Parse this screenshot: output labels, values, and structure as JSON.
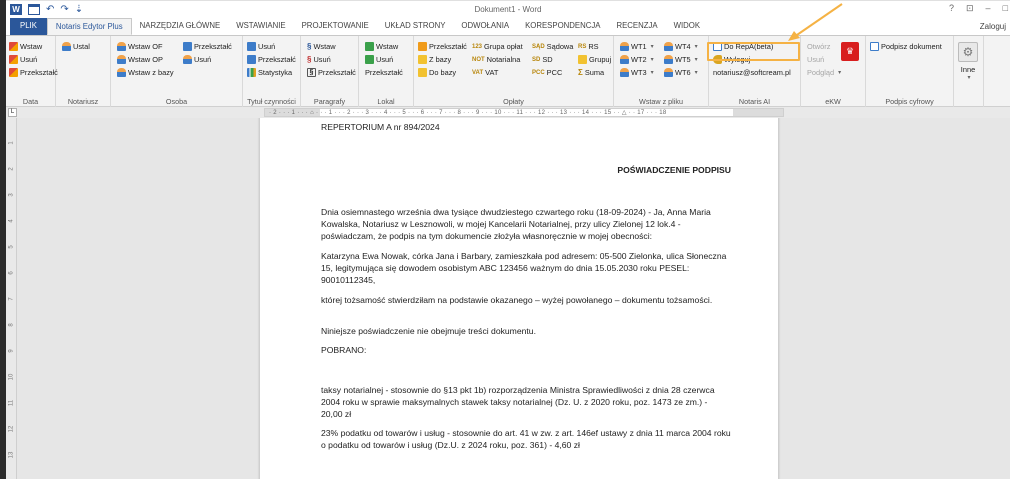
{
  "window": {
    "title": "Dokument1 - Word",
    "controls": [
      "?",
      "⊡",
      "–",
      "□"
    ],
    "login": "Zaloguj"
  },
  "quick_access": [
    "word-logo",
    "save-icon",
    "undo-icon",
    "redo-icon",
    "customize-icon"
  ],
  "tabs": [
    "PLIK",
    "Notaris Edytor Plus",
    "NARZĘDZIA GŁÓWNE",
    "WSTAWIANIE",
    "PROJEKTOWANIE",
    "UKŁAD STRONY",
    "ODWOŁANIA",
    "KORESPONDENCJA",
    "RECENZJA",
    "WIDOK"
  ],
  "ribbon": {
    "data": {
      "label": "Data",
      "items": [
        "Wstaw",
        "Usuń",
        "Przekształć"
      ]
    },
    "notariusz": {
      "label": "Notariusz",
      "items": [
        "Ustal"
      ]
    },
    "osoba": {
      "label": "Osoba",
      "items": [
        "Wstaw OF",
        "Przekształć",
        "Wstaw OP",
        "Usuń",
        "Wstaw z bazy"
      ]
    },
    "tytul": {
      "label": "Tytuł czynności",
      "items": [
        "Usuń",
        "Przekształć",
        "Statystyka"
      ]
    },
    "paragrafy": {
      "label": "Paragrafy",
      "items": [
        "Wstaw",
        "Usuń",
        "Przekształć"
      ]
    },
    "lokal": {
      "label": "Lokal",
      "items": [
        "Wstaw",
        "Usuń",
        "Przekształć"
      ]
    },
    "oplaty": {
      "label": "Opłaty",
      "items": [
        "Przekształć",
        "Z bazy",
        "Do bazy",
        "Grupa opłat",
        "Notarialna",
        "VAT",
        "Sądowa",
        "SD",
        "PCC",
        "RS",
        "Grupuj",
        "Suma"
      ]
    },
    "wstaw_z_pliku": {
      "label": "Wstaw z pliku",
      "items": [
        "WT1",
        "WT4",
        "WT2",
        "WT5",
        "WT3",
        "WT6"
      ]
    },
    "notaris_ai": {
      "label": "Notaris AI",
      "items": [
        "Do RepA(beta)",
        "Wyloguj",
        "notariusz@softcream.pl"
      ]
    },
    "ekw": {
      "label": "eKW",
      "items": [
        "Otwórz",
        "Usuń",
        "Podgląd"
      ]
    },
    "podpis": {
      "label": "Podpis cyfrowy",
      "items": [
        "Podpisz dokument"
      ]
    },
    "inne": {
      "label": "",
      "items": [
        "Inne"
      ]
    }
  },
  "tags": {
    "grupa": "123",
    "notarialna": "NOT",
    "vat": "VAT",
    "sadowa": "SĄD",
    "sd": "SD",
    "pcc": "PCC",
    "rs": "RS",
    "suma": "Σ"
  },
  "ruler": {
    "corner": "L",
    "scale": "· 2 · · · 1 · · · ⌂ · · · 1 · · · 2 · · · 3 · · · 4 · · · 5 · · · 6 · · · 7 · · · 8 · · · 9 · · · 10 · · · 11 · · · 12 · · · 13 · · · 14 · · · 15 · · △ · · 17 · · · 18",
    "vertical": [
      "1",
      "2",
      "3",
      "4",
      "5",
      "6",
      "7",
      "8",
      "9",
      "10",
      "11",
      "12",
      "13"
    ]
  },
  "document": {
    "p1": "REPERTORIUM A nr 894/2024",
    "p2": "POŚWIADCZENIE PODPISU",
    "p3": "Dnia osiemnastego września dwa tysiące dwudziestego czwartego roku (18-09-2024) - Ja, Anna Maria Kowalska, Notariusz w Lesznowoli, w mojej Kancelarii Notarialnej, przy ulicy Zielonej 12 lok.4 - poświadczam, że podpis na tym dokumencie złożyła własnoręcznie w mojej obecności:",
    "p4": "Katarzyna Ewa Nowak, córka Jana i Barbary, zamieszkała pod adresem: 05-500 Zielonka, ulica Słoneczna 15, legitymująca się dowodem osobistym ABC 123456 ważnym do dnia 15.05.2030 roku PESEL: 90010112345,",
    "p5": "której tożsamość stwierdziłam na podstawie okazanego – wyżej powołanego – dokumentu tożsamości.",
    "p6": "Niniejsze poświadczenie nie obejmuje treści dokumentu.",
    "p7": "POBRANO:",
    "p8": "taksy notarialnej - stosownie do §13 pkt 1b) rozporządzenia Ministra Sprawiedliwości z dnia 28 czerwca 2004 roku w sprawie maksymalnych stawek taksy notarialnej (Dz. U. z 2020 roku, poz. 1473 ze zm.) - 20,00 zł",
    "p9": "23% podatku od towarów i usług - stosownie do art. 41 w zw. z art. 146ef ustawy z dnia 11 marca 2004 roku o podatku od towarów i usług (Dz.U. z 2024 roku, poz. 361) - 4,60 zł"
  },
  "colors": {
    "accent": "#2b579a",
    "highlight": "#f5b244"
  }
}
